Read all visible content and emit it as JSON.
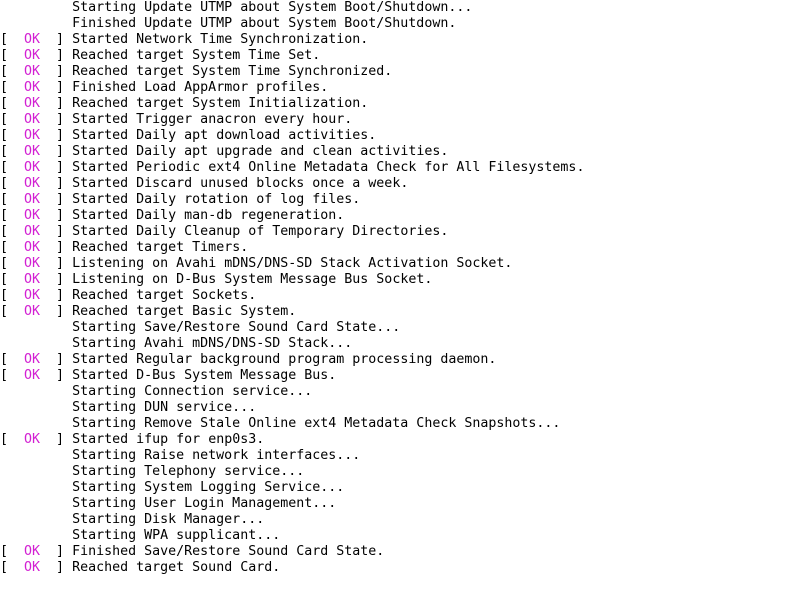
{
  "console": {
    "ok_label": "OK",
    "ok_color": "#d21fd2",
    "lines": [
      {
        "status": "",
        "verb": "Starting",
        "target": "Update UTMP about System Boot/Shutdown..."
      },
      {
        "status": "",
        "verb": "Finished",
        "target": "Update UTMP about System Boot/Shutdown."
      },
      {
        "status": "OK",
        "verb": "Started",
        "target": "Network Time Synchronization."
      },
      {
        "status": "OK",
        "verb": "Reached target",
        "target": "System Time Set."
      },
      {
        "status": "OK",
        "verb": "Reached target",
        "target": "System Time Synchronized."
      },
      {
        "status": "OK",
        "verb": "Finished",
        "target": "Load AppArmor profiles."
      },
      {
        "status": "OK",
        "verb": "Reached target",
        "target": "System Initialization."
      },
      {
        "status": "OK",
        "verb": "Started",
        "target": "Trigger anacron every hour."
      },
      {
        "status": "OK",
        "verb": "Started",
        "target": "Daily apt download activities."
      },
      {
        "status": "OK",
        "verb": "Started",
        "target": "Daily apt upgrade and clean activities."
      },
      {
        "status": "OK",
        "verb": "Started",
        "target": "Periodic ext4 Online Metadata Check for All Filesystems."
      },
      {
        "status": "OK",
        "verb": "Started",
        "target": "Discard unused blocks once a week."
      },
      {
        "status": "OK",
        "verb": "Started",
        "target": "Daily rotation of log files."
      },
      {
        "status": "OK",
        "verb": "Started",
        "target": "Daily man-db regeneration."
      },
      {
        "status": "OK",
        "verb": "Started",
        "target": "Daily Cleanup of Temporary Directories."
      },
      {
        "status": "OK",
        "verb": "Reached target",
        "target": "Timers."
      },
      {
        "status": "OK",
        "verb": "Listening on",
        "target": "Avahi mDNS/DNS-SD Stack Activation Socket."
      },
      {
        "status": "OK",
        "verb": "Listening on",
        "target": "D-Bus System Message Bus Socket."
      },
      {
        "status": "OK",
        "verb": "Reached target",
        "target": "Sockets."
      },
      {
        "status": "OK",
        "verb": "Reached target",
        "target": "Basic System."
      },
      {
        "status": "",
        "verb": "Starting",
        "target": "Save/Restore Sound Card State..."
      },
      {
        "status": "",
        "verb": "Starting",
        "target": "Avahi mDNS/DNS-SD Stack..."
      },
      {
        "status": "OK",
        "verb": "Started",
        "target": "Regular background program processing daemon."
      },
      {
        "status": "OK",
        "verb": "Started",
        "target": "D-Bus System Message Bus."
      },
      {
        "status": "",
        "verb": "Starting",
        "target": "Connection service..."
      },
      {
        "status": "",
        "verb": "Starting",
        "target": "DUN service..."
      },
      {
        "status": "",
        "verb": "Starting",
        "target": "Remove Stale Online ext4 Metadata Check Snapshots..."
      },
      {
        "status": "OK",
        "verb": "Started",
        "target": "ifup for enp0s3."
      },
      {
        "status": "",
        "verb": "Starting",
        "target": "Raise network interfaces..."
      },
      {
        "status": "",
        "verb": "Starting",
        "target": "Telephony service..."
      },
      {
        "status": "",
        "verb": "Starting",
        "target": "System Logging Service..."
      },
      {
        "status": "",
        "verb": "Starting",
        "target": "User Login Management..."
      },
      {
        "status": "",
        "verb": "Starting",
        "target": "Disk Manager..."
      },
      {
        "status": "",
        "verb": "Starting",
        "target": "WPA supplicant..."
      },
      {
        "status": "OK",
        "verb": "Finished",
        "target": "Save/Restore Sound Card State."
      },
      {
        "status": "OK",
        "verb": "Reached target",
        "target": "Sound Card."
      }
    ]
  }
}
